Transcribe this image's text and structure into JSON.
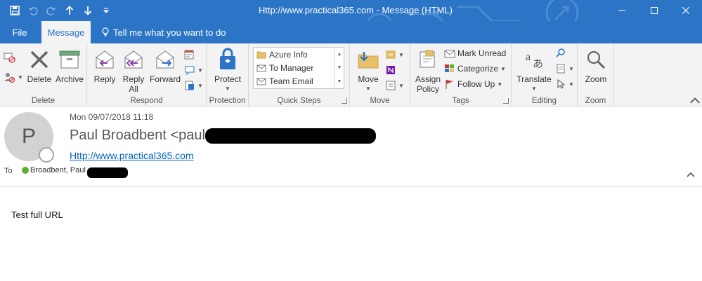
{
  "window": {
    "title": "Http://www.practical365.com  -  Message (HTML)"
  },
  "tabs": [
    {
      "label": "File",
      "active": false
    },
    {
      "label": "Message",
      "active": true
    }
  ],
  "tell_me": "Tell me what you want to do",
  "ribbon": {
    "delete_group": {
      "label": "Delete",
      "delete": "Delete",
      "archive": "Archive"
    },
    "respond_group": {
      "label": "Respond",
      "reply": "Reply",
      "reply_all_line1": "Reply",
      "reply_all_line2": "All",
      "forward": "Forward"
    },
    "protection_group": {
      "label": "Protection",
      "protect": "Protect"
    },
    "quick_steps_group": {
      "label": "Quick Steps",
      "items": [
        "Azure Info",
        "To Manager",
        "Team Email"
      ]
    },
    "move_group": {
      "label": "Move",
      "move": "Move"
    },
    "tags_group": {
      "label": "Tags",
      "assign_policy_line1": "Assign",
      "assign_policy_line2": "Policy",
      "mark_unread": "Mark Unread",
      "categorize": "Categorize",
      "follow_up": "Follow Up"
    },
    "editing_group": {
      "label": "Editing",
      "translate": "Translate"
    },
    "zoom_group": {
      "label": "Zoom",
      "zoom": "Zoom"
    }
  },
  "message": {
    "avatar_initial": "P",
    "date": "Mon 09/07/2018 11:18",
    "from": "Paul Broadbent <paul",
    "url": "Http://www.practical365.com",
    "to_label": "To",
    "to_name": "Broadbent, Paul",
    "body": "Test full URL"
  },
  "colors": {
    "titlebar": "#2B74C6",
    "ribbon": "#F3F3F3",
    "link": "#0563C1",
    "presence_green": "#5DB130"
  }
}
